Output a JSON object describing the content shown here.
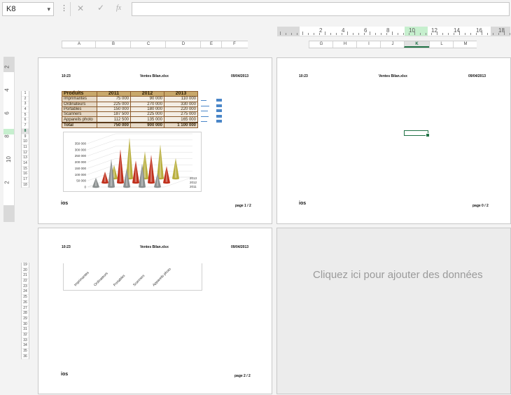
{
  "formula_bar": {
    "name_box": "K8",
    "fx_label": "fx",
    "cancel": "✕",
    "enter": "✓",
    "dots": "⋮"
  },
  "ruler": {
    "numbers": [
      "2",
      "4",
      "6",
      "8",
      "10",
      "12",
      "14",
      "16",
      "18"
    ],
    "vnumbers": [
      "2",
      "4",
      "6",
      "8",
      "10",
      "2"
    ]
  },
  "columns_left": [
    "A",
    "B",
    "C",
    "D",
    "E",
    "F"
  ],
  "columns_right": [
    "G",
    "H",
    "I",
    "J",
    "K",
    "L",
    "M"
  ],
  "selected_column": "K",
  "rows_page1": [
    "1",
    "2",
    "3",
    "4",
    "5",
    "6",
    "7",
    "8",
    "9",
    "10",
    "11",
    "12",
    "13",
    "14",
    "15",
    "16",
    "17",
    "18"
  ],
  "rows_page3": [
    "19",
    "20",
    "21",
    "22",
    "23",
    "24",
    "25",
    "26",
    "27",
    "28",
    "29",
    "30",
    "31",
    "32",
    "33",
    "34",
    "35",
    "36"
  ],
  "page_header": {
    "time": "10:23",
    "file": "Ventes Bilan.xlsx",
    "date": "09/04/2013"
  },
  "footer": {
    "left": "ios",
    "page1": "page 1 / 2",
    "page2": "page 0 / 2",
    "page3": "page 2 / 2"
  },
  "table": {
    "header": [
      "Produits",
      "2011",
      "2012",
      "2013"
    ],
    "rows": [
      [
        "Imprimantes",
        "75 000",
        "90 000",
        "110 000"
      ],
      [
        "Ordinateurs",
        "225 000",
        "270 000",
        "330 000"
      ],
      [
        "Portables",
        "150 000",
        "180 000",
        "220 000"
      ],
      [
        "Scanners",
        "187 500",
        "225 000",
        "275 000"
      ],
      [
        "Appareils photo",
        "112 500",
        "135 000",
        "165 000"
      ]
    ],
    "total": [
      "Total",
      "750 000",
      "900 000",
      "1 100 000"
    ]
  },
  "chart_data": {
    "type": "bar",
    "categories": [
      "Imprimantes",
      "Ordinateurs",
      "Portables",
      "Scanners",
      "Appareils photo"
    ],
    "series": [
      {
        "name": "2011",
        "values": [
          75000,
          225000,
          150000,
          187500,
          112500
        ]
      },
      {
        "name": "2012",
        "values": [
          90000,
          270000,
          180000,
          225000,
          135000
        ]
      },
      {
        "name": "2013",
        "values": [
          110000,
          330000,
          220000,
          275000,
          165000
        ]
      }
    ],
    "yticks": [
      "350 000",
      "300 000",
      "250 000",
      "200 000",
      "150 000",
      "100 000",
      "50 000",
      "0"
    ],
    "ylim": [
      0,
      350000
    ],
    "colors": [
      "#8a8f8f",
      "#c0301c",
      "#b8ae3c"
    ]
  },
  "placeholder": "Cliquez ici pour ajouter des données"
}
